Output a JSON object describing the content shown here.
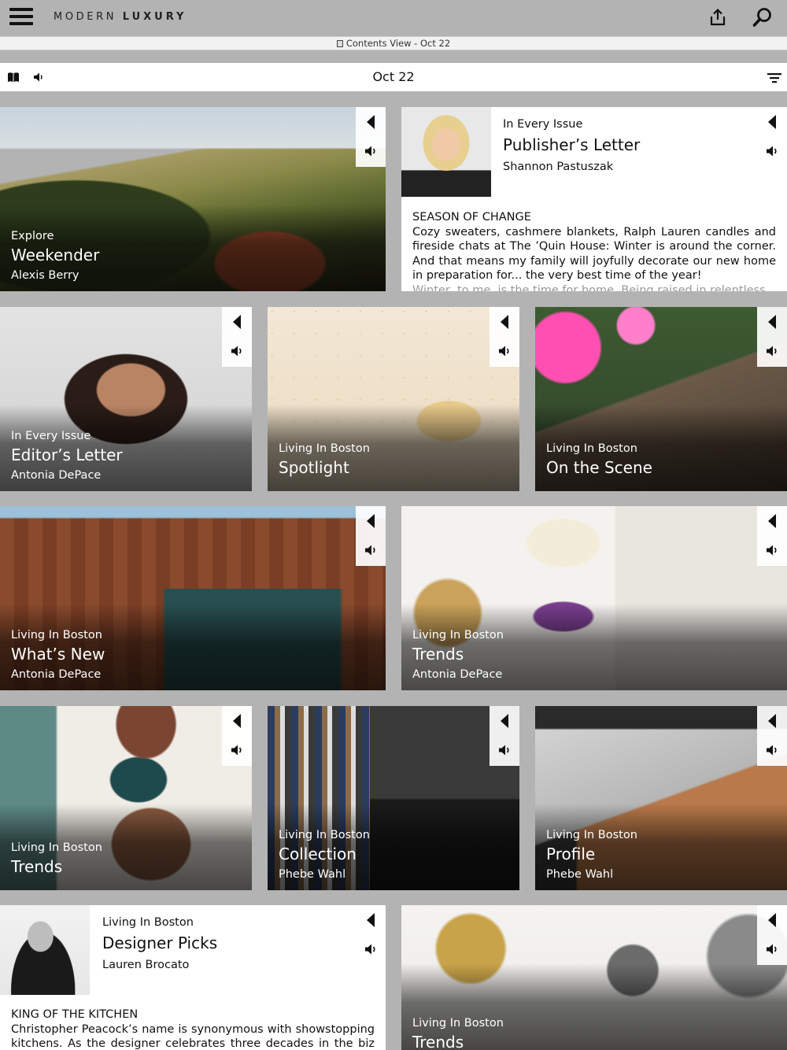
{
  "app": {
    "logo_light": "MODERN",
    "logo_bold": "LUXURY"
  },
  "viewbar": {
    "label": "Contents View - Oct 22"
  },
  "datebar": {
    "title": "Oct 22"
  },
  "icons": {
    "menu": "hamburger-menu-icon",
    "share": "share-icon",
    "search": "search-icon",
    "book": "book-icon",
    "speaker": "speaker-icon",
    "filter": "filter-icon",
    "back": "play-back-triangle-icon"
  },
  "cards": [
    {
      "section": "Explore",
      "headline": "Weekender",
      "byline": "Alexis Berry"
    },
    {
      "section": "In Every Issue",
      "headline": "Publisher’s Letter",
      "byline": "Shannon Pastuszak",
      "excerpt_title": "SEASON OF CHANGE",
      "excerpt": "Cozy sweaters, cashmere blankets, Ralph Lauren candles and fireside chats at The ’Quin House: Winter is around the corner. And that means my family will joyfully decorate our new home in preparation for... the very best time of the year!",
      "excerpt_more": "Winter, to me, is the time for home. Being raised in relentless"
    },
    {
      "section": "In Every Issue",
      "headline": "Editor’s Letter",
      "byline": "Antonia DePace"
    },
    {
      "section": "Living In Boston",
      "headline": "Spotlight",
      "byline": ""
    },
    {
      "section": "Living In Boston",
      "headline": "On the Scene",
      "byline": ""
    },
    {
      "section": "Living In Boston",
      "headline": "What’s New",
      "byline": "Antonia DePace"
    },
    {
      "section": "Living In Boston",
      "headline": "Trends",
      "byline": "Antonia DePace"
    },
    {
      "section": "Living In Boston",
      "headline": "Trends",
      "byline": ""
    },
    {
      "section": "Living In Boston",
      "headline": "Collection",
      "byline": "Phebe Wahl"
    },
    {
      "section": "Living In Boston",
      "headline": "Profile",
      "byline": "Phebe Wahl"
    },
    {
      "section": "Living In Boston",
      "headline": "Designer Picks",
      "byline": "Lauren Brocato",
      "excerpt_title": "KING OF THE KITCHEN",
      "excerpt": "Christopher Peacock’s name is synonymous with showstopping kitchens. As the designer celebrates three decades in the biz this"
    },
    {
      "section": "Living In Boston",
      "headline": "Trends",
      "byline": ""
    }
  ],
  "colors": {
    "background": "#b3b3b3",
    "bar": "#ffffff",
    "text": "#111111"
  }
}
